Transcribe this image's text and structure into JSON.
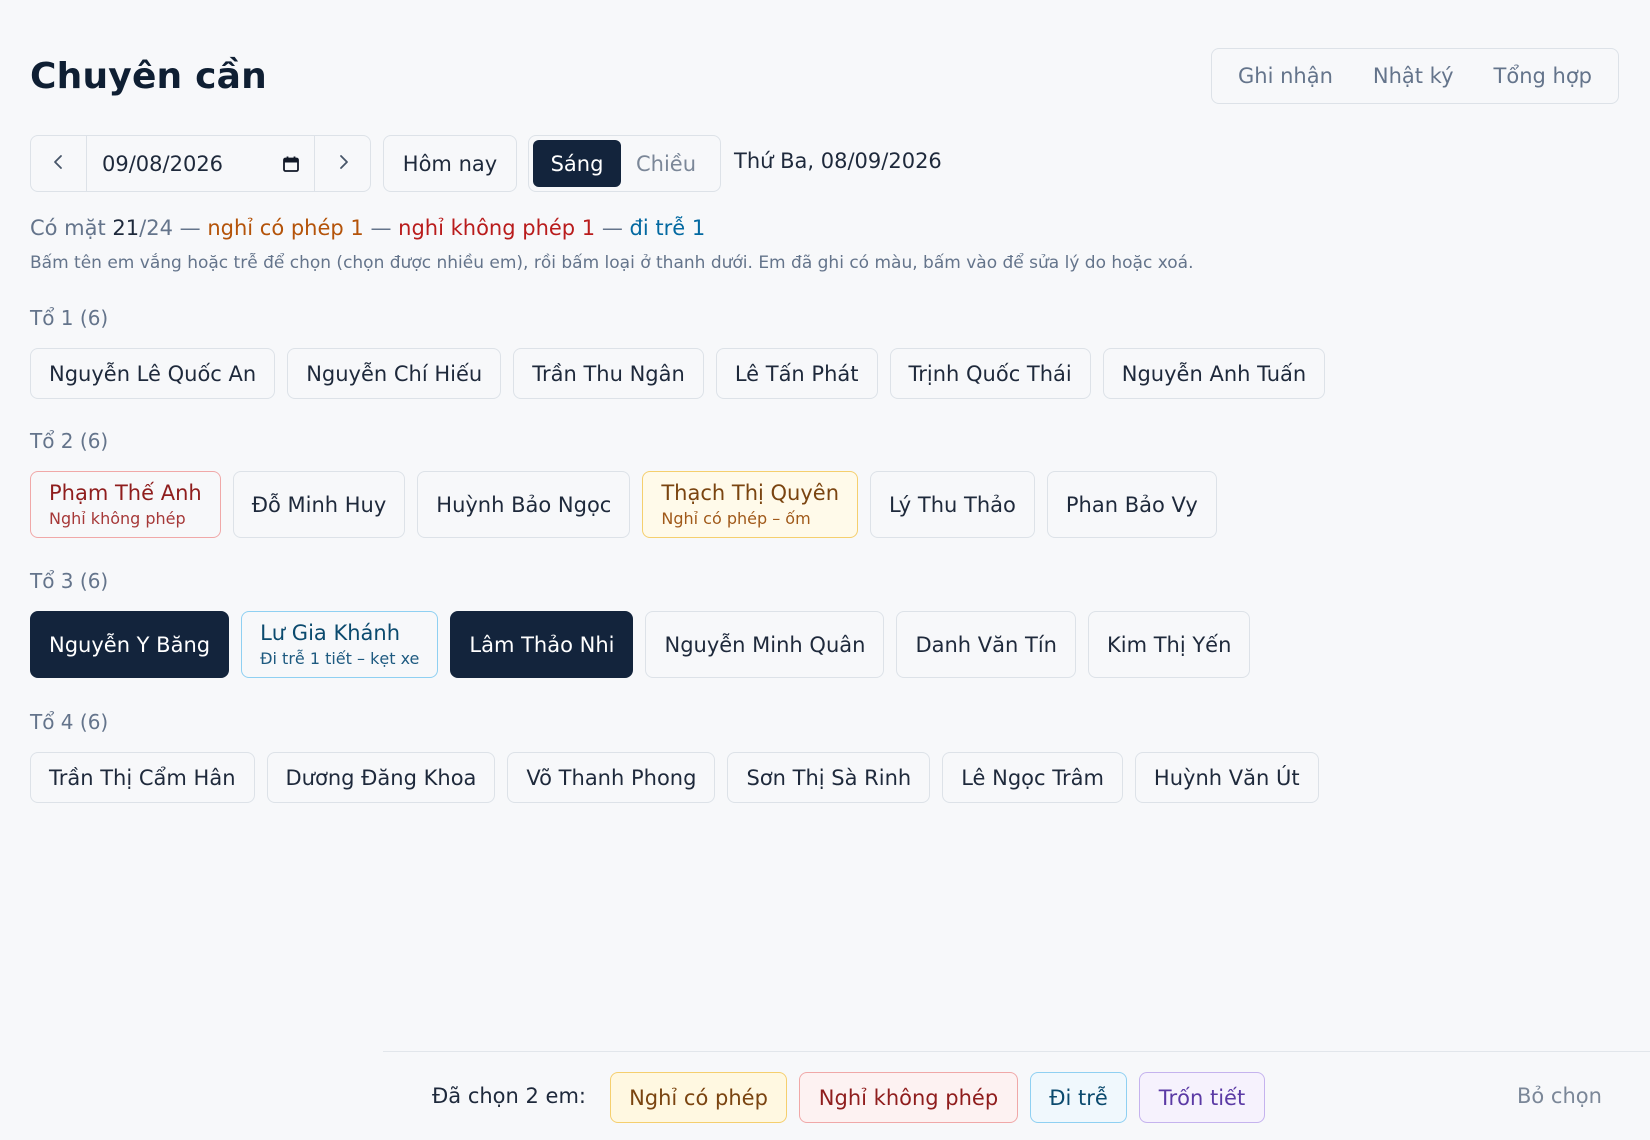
{
  "app": {
    "title": "Chuyên cần"
  },
  "view_tabs": [
    "Ghi nhận",
    "Nhật ký",
    "Tổng hợp"
  ],
  "toolbar": {
    "date_value": "09/08/2026",
    "today_label": "Hôm nay",
    "sessions": {
      "morning": "Sáng",
      "afternoon": "Chiều",
      "selected": "Sáng"
    },
    "date_label": "Thứ Ba, 08/09/2026"
  },
  "summary": {
    "present_prefix": "Có mặt ",
    "present": "21",
    "total": "/24",
    "separator": " — ",
    "excused": "nghỉ có phép 1",
    "unexcused": "nghỉ không phép 1",
    "late": "đi trễ 1",
    "hint": "Bấm tên em vắng hoặc trễ để chọn (chọn được nhiều em), rồi bấm loại ở thanh dưới. Em đã ghi có màu, bấm vào để sửa lý do hoặc xoá."
  },
  "groups": [
    {
      "label": "Tổ 1 (6)",
      "students": [
        {
          "name": "Nguyễn Lê Quốc An",
          "status": "present",
          "note": ""
        },
        {
          "name": "Nguyễn Chí Hiếu",
          "status": "present",
          "note": ""
        },
        {
          "name": "Trần Thu Ngân",
          "status": "present",
          "note": ""
        },
        {
          "name": "Lê Tấn Phát",
          "status": "present",
          "note": ""
        },
        {
          "name": "Trịnh Quốc Thái",
          "status": "present",
          "note": ""
        },
        {
          "name": "Nguyễn Anh Tuấn",
          "status": "present",
          "note": ""
        }
      ]
    },
    {
      "label": "Tổ 2 (6)",
      "students": [
        {
          "name": "Phạm Thế Anh",
          "status": "unexcused",
          "note": "Nghỉ không phép"
        },
        {
          "name": "Đỗ Minh Huy",
          "status": "present",
          "note": ""
        },
        {
          "name": "Huỳnh Bảo Ngọc",
          "status": "present",
          "note": ""
        },
        {
          "name": "Thạch Thị Quyên",
          "status": "excused",
          "note": "Nghỉ có phép – ốm"
        },
        {
          "name": "Lý Thu Thảo",
          "status": "present",
          "note": ""
        },
        {
          "name": "Phan Bảo Vy",
          "status": "present",
          "note": ""
        }
      ]
    },
    {
      "label": "Tổ 3 (6)",
      "students": [
        {
          "name": "Nguyễn Y Băng",
          "status": "selected",
          "note": ""
        },
        {
          "name": "Lư Gia Khánh",
          "status": "late",
          "note": "Đi trễ 1 tiết – kẹt xe"
        },
        {
          "name": "Lâm Thảo Nhi",
          "status": "selected",
          "note": ""
        },
        {
          "name": "Nguyễn Minh Quân",
          "status": "present",
          "note": ""
        },
        {
          "name": "Danh Văn Tín",
          "status": "present",
          "note": ""
        },
        {
          "name": "Kim Thị Yến",
          "status": "present",
          "note": ""
        }
      ]
    },
    {
      "label": "Tổ 4 (6)",
      "students": [
        {
          "name": "Trần Thị Cẩm Hân",
          "status": "present",
          "note": ""
        },
        {
          "name": "Dương Đăng Khoa",
          "status": "present",
          "note": ""
        },
        {
          "name": "Võ Thanh Phong",
          "status": "present",
          "note": ""
        },
        {
          "name": "Sơn Thị Sà Rinh",
          "status": "present",
          "note": ""
        },
        {
          "name": "Lê Ngọc Trâm",
          "status": "present",
          "note": ""
        },
        {
          "name": "Huỳnh Văn Út",
          "status": "present",
          "note": ""
        }
      ]
    }
  ],
  "action_bar": {
    "selected_count": "Đã chọn 2 em:",
    "excused": "Nghỉ có phép",
    "unexcused": "Nghỉ không phép",
    "late": "Đi trễ",
    "truant": "Trốn tiết",
    "clear": "Bỏ chọn"
  },
  "colors": {
    "primary": "#13243c",
    "excused": "#b45309",
    "unexcused": "#b91c1c",
    "late": "#0369a1",
    "truant": "#5b3aa5"
  },
  "icons": {
    "prev": "chevron-left-icon",
    "next": "chevron-right-icon",
    "calendar": "calendar-icon"
  }
}
